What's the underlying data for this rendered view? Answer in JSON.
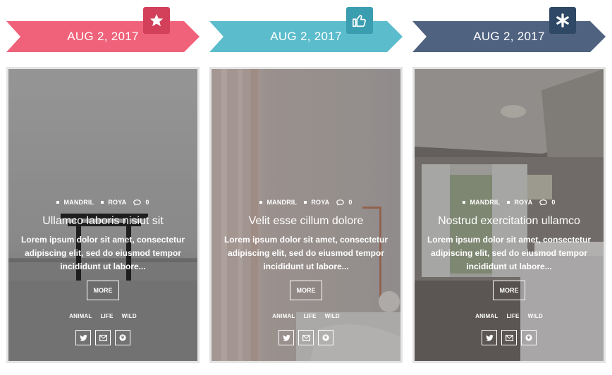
{
  "colors": {
    "pink": "#f0627a",
    "pink_badge": "#d2405a",
    "teal": "#5bbccc",
    "teal_badge": "#3a9eb0",
    "slate": "#4f6280",
    "slate_badge": "#2f4866"
  },
  "posts": [
    {
      "date": "AUG 2, 2017",
      "badge_icon": "star-icon",
      "author": "MANDRIL",
      "category": "ROYA",
      "comments": "0",
      "title": "Ullamco laboris nisiut sit",
      "excerpt": "Lorem ipsum dolor sit amet, consectetur adipiscing elit, sed do eiusmod tempor incididunt ut labore...",
      "more_label": "MORE",
      "tags": [
        "ANIMAL",
        "LIFE",
        "WILD"
      ],
      "socials": [
        "twitter-icon",
        "envelope-icon",
        "pinterest-icon"
      ]
    },
    {
      "date": "AUG 2, 2017",
      "badge_icon": "thumbs-up-icon",
      "author": "MANDRIL",
      "category": "ROYA",
      "comments": "0",
      "title": "Velit esse cillum dolore",
      "excerpt": "Lorem ipsum dolor sit amet, consectetur adipiscing elit, sed do eiusmod tempor incididunt ut labore...",
      "more_label": "MORE",
      "tags": [
        "ANIMAL",
        "LIFE",
        "WILD"
      ],
      "socials": [
        "twitter-icon",
        "envelope-icon",
        "pinterest-icon"
      ]
    },
    {
      "date": "AUG 2, 2017",
      "badge_icon": "asterisk-icon",
      "author": "MANDRIL",
      "category": "ROYA",
      "comments": "0",
      "title": "Nostrud exercitation ullamco",
      "excerpt": "Lorem ipsum dolor sit amet, consectetur adipiscing elit, sed do eiusmod tempor incididunt ut labore...",
      "more_label": "MORE",
      "tags": [
        "ANIMAL",
        "LIFE",
        "WILD"
      ],
      "socials": [
        "twitter-icon",
        "envelope-icon",
        "pinterest-icon"
      ]
    }
  ]
}
